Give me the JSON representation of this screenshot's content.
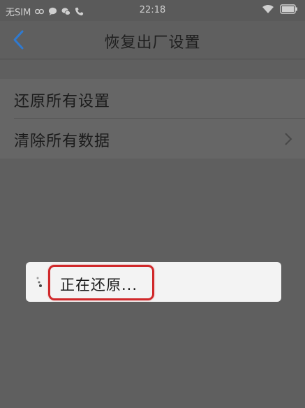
{
  "status_bar": {
    "carrier": "无SIM",
    "time": "22:18",
    "icons": [
      "usb-icon",
      "chat-icon",
      "wechat-icon",
      "phone-icon",
      "wifi-icon",
      "battery-icon"
    ]
  },
  "header": {
    "title": "恢复出厂设置",
    "back_icon": "chevron-left-icon"
  },
  "list": {
    "items": [
      {
        "label": "还原所有设置"
      },
      {
        "label": "清除所有数据",
        "icon": "chevron-right-icon"
      }
    ]
  },
  "dialog": {
    "message": "正在还原..."
  },
  "colors": {
    "accent_blue": "#2f7ad1",
    "highlight_red": "#d0282a",
    "dialog_bg": "#f3f3f3"
  }
}
